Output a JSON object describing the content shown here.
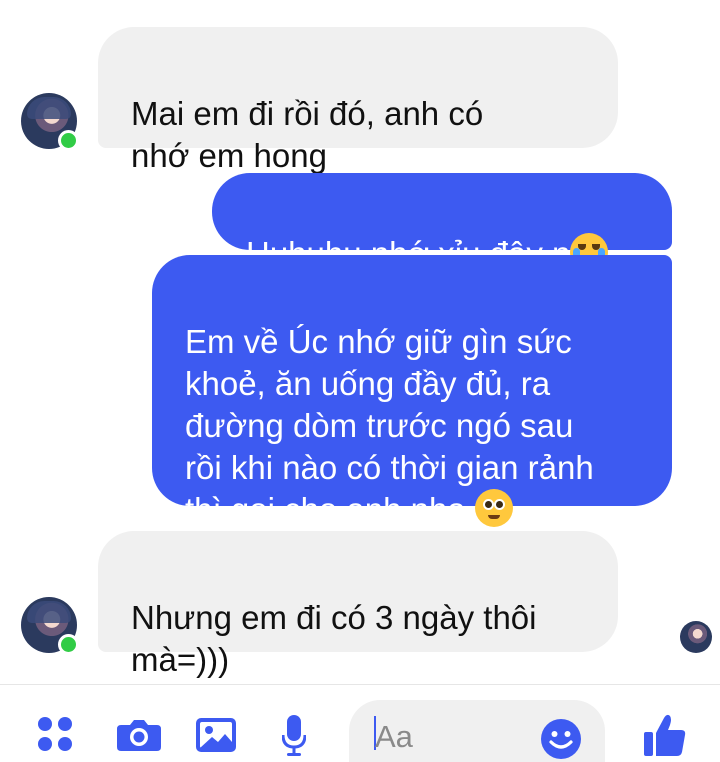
{
  "messages": [
    {
      "id": "msg1",
      "direction": "incoming",
      "text": "Mai em đi rồi đó, anh có\nnhớ em hong"
    },
    {
      "id": "msg2",
      "direction": "outgoing",
      "text": "Huhuhu nhớ xỉu đây n",
      "emoji": "loudly-crying-face"
    },
    {
      "id": "msg3",
      "direction": "outgoing",
      "text": "Em về Úc nhớ giữ gìn sức\nkhoẻ, ăn uống đầy đủ, ra\nđường dòm trước ngó sau\nrồi khi nào có thời gian rảnh\nthì gọi cho anh nha ",
      "emoji": "pleading-face"
    },
    {
      "id": "msg4",
      "direction": "incoming",
      "text": "Nhưng em đi có 3 ngày thôi\nmà=)))"
    }
  ],
  "composer": {
    "placeholder": "Aa",
    "icons": [
      "more-icon",
      "camera-icon",
      "photo-icon",
      "microphone-icon",
      "smile-icon",
      "thumbs-up-icon"
    ]
  },
  "colors": {
    "accent": "#3d5af1",
    "incoming_bubble": "#f0f0f0",
    "online": "#31cc46"
  }
}
